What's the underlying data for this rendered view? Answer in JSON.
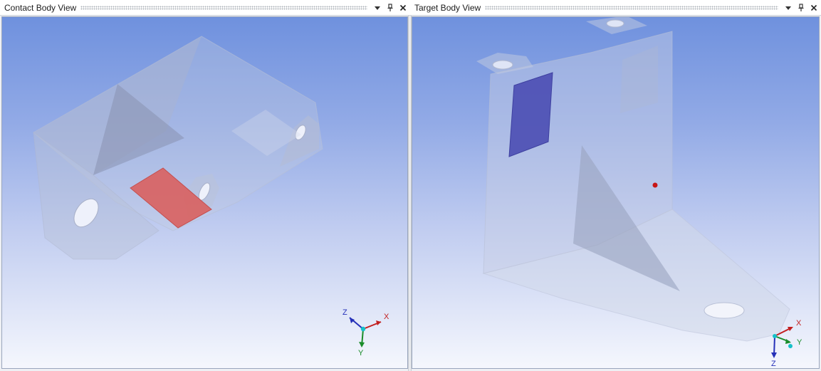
{
  "panes": [
    {
      "title": "Contact Body View",
      "triad": {
        "x_label": "X",
        "y_label": "Y",
        "z_label": "Z"
      }
    },
    {
      "title": "Target Body View",
      "triad": {
        "x_label": "X",
        "y_label": "Y",
        "z_label": "Z"
      }
    }
  ],
  "colors": {
    "contact_face": "#d9605f",
    "target_face": "#4d4fb4",
    "marker": "#c81616"
  }
}
